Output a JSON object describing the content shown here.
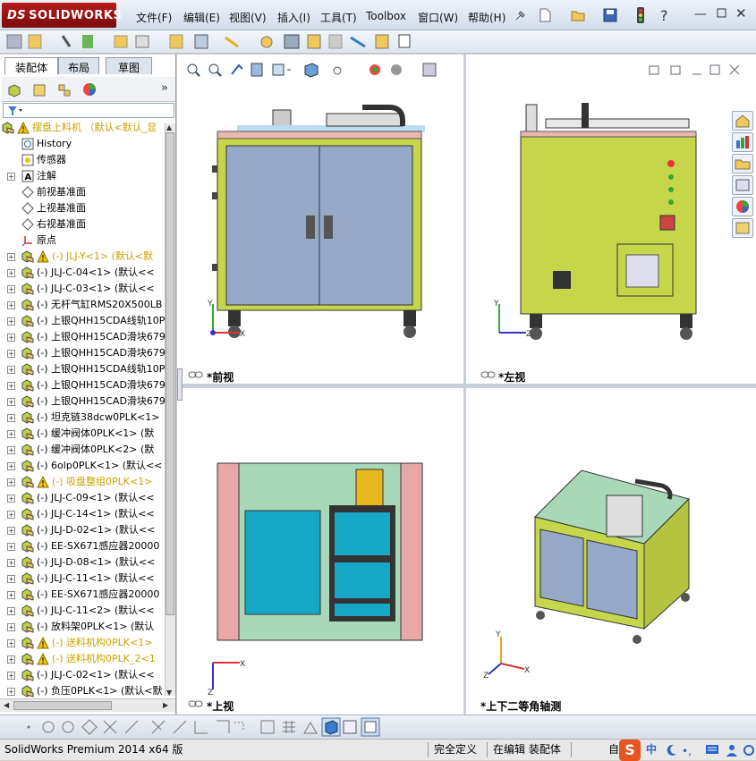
{
  "app": {
    "logo": "SOLIDWORKS",
    "logo_prefix": "DS"
  },
  "menu": [
    "文件(F)",
    "编辑(E)",
    "视图(V)",
    "插入(I)",
    "工具(T)",
    "Toolbox",
    "窗口(W)",
    "帮助(H)"
  ],
  "panel_tabs": [
    "装配体",
    "布局",
    "草图"
  ],
  "tree": {
    "root": "摆盘上料机  （默认<默认_显",
    "fixed_items": [
      "History",
      "传感器",
      "注解",
      "前视基准面",
      "上视基准面",
      "右视基准面",
      "原点"
    ],
    "components": [
      {
        "label": "(-) JLJ-Y<1> (默认<默",
        "warn": true
      },
      {
        "label": "(-) JLJ-C-04<1> (默认<<",
        "warn": false
      },
      {
        "label": "(-) JLJ-C-03<1> (默认<<",
        "warn": false
      },
      {
        "label": "(-) 无杆气缸RMS20X500LB",
        "warn": false
      },
      {
        "label": "(-) 上银QHH15CDA线轨10P",
        "warn": false
      },
      {
        "label": "(-) 上银QHH15CAD滑块679",
        "warn": false
      },
      {
        "label": "(-) 上银QHH15CAD滑块679",
        "warn": false
      },
      {
        "label": "(-) 上银QHH15CDA线轨10P",
        "warn": false
      },
      {
        "label": "(-) 上银QHH15CAD滑块679",
        "warn": false
      },
      {
        "label": "(-) 上银QHH15CAD滑块679",
        "warn": false
      },
      {
        "label": "(-) 坦克链38dcw0PLK<1>",
        "warn": false
      },
      {
        "label": "(-) 缓冲阀体0PLK<1> (默",
        "warn": false
      },
      {
        "label": "(-) 缓冲阀体0PLK<2> (默",
        "warn": false
      },
      {
        "label": "(-) 6olp0PLK<1> (默认<<",
        "warn": false
      },
      {
        "label": "(-) 吸盘整组0PLK<1>",
        "warn": true
      },
      {
        "label": "(-) JLJ-C-09<1> (默认<<",
        "warn": false
      },
      {
        "label": "(-) JLJ-C-14<1> (默认<<",
        "warn": false
      },
      {
        "label": "(-) JLJ-D-02<1> (默认<<",
        "warn": false
      },
      {
        "label": "(-) EE-SX671感应器20000",
        "warn": false
      },
      {
        "label": "(-) JLJ-D-08<1> (默认<<",
        "warn": false
      },
      {
        "label": "(-) JLJ-C-11<1> (默认<<",
        "warn": false
      },
      {
        "label": "(-) EE-SX671感应器20000",
        "warn": false
      },
      {
        "label": "(-) JLJ-C-11<2> (默认<<",
        "warn": false
      },
      {
        "label": "(-) 放料架0PLK<1> (默认",
        "warn": false
      },
      {
        "label": "(-) 送料机构0PLK<1>",
        "warn": true
      },
      {
        "label": "(-) 送料机构0PLK_2<1",
        "warn": true
      },
      {
        "label": "(-) JLJ-C-02<1> (默认<<",
        "warn": false
      },
      {
        "label": "(-) 负压0PLK<1> (默认<默",
        "warn": false
      }
    ]
  },
  "views": {
    "front": "*前视",
    "left": "*左视",
    "top": "*上视",
    "iso": "*上下二等角轴测"
  },
  "axes": {
    "x": "X",
    "y": "Y",
    "z": "Z"
  },
  "status": {
    "version": "SolidWorks Premium 2014 x64 版",
    "defined": "完全定义",
    "editing": "在编辑 装配体",
    "ime_prefix": "自",
    "ime": "中"
  },
  "colors": {
    "cabinet": "#c6d64a",
    "door": "#95a8c8",
    "warning": "#f1c40f",
    "accent_red": "#c41e1e"
  }
}
